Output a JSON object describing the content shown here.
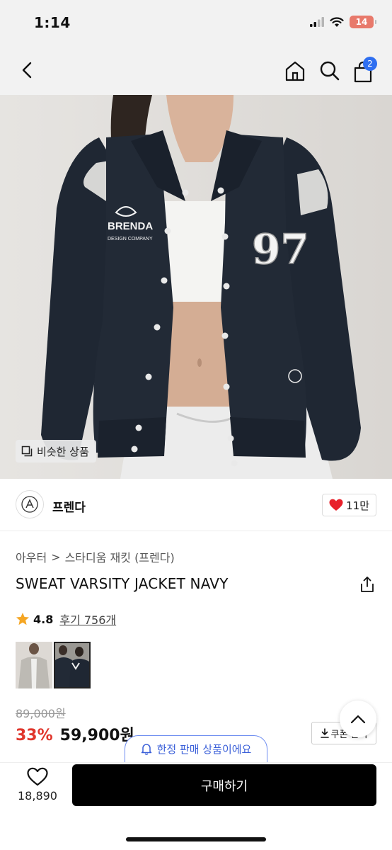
{
  "status_bar": {
    "time": "1:14",
    "battery": "14"
  },
  "nav": {
    "cart_count": "2"
  },
  "similar_button": {
    "label": "비슷한 상품"
  },
  "jacket_print": {
    "logo_line1": "BRENDA",
    "logo_line2": "DESIGN COMPANY",
    "number": "97"
  },
  "brand": {
    "name": "프렌다",
    "likes": "11만"
  },
  "breadcrumb": {
    "category": "아우터",
    "separator": ">",
    "subcategory": "스타디움 재킷 (프렌다)"
  },
  "product": {
    "title": "SWEAT VARSITY JACKET NAVY"
  },
  "rating": {
    "value": "4.8",
    "review_label": "후기 756개"
  },
  "price": {
    "original": "89,000원",
    "discount": "33%",
    "sale": "59,900원"
  },
  "coupon": {
    "label": "쿠폰 받기"
  },
  "toast": {
    "label": "한정 판매 상품이에요"
  },
  "bottom_bar": {
    "wish_count": "18,890",
    "buy_label": "구매하기"
  },
  "colors": {
    "accent_blue": "#2f6ff0",
    "discount_red": "#e0362c",
    "heart_red": "#e8202a",
    "star": "#f5a623"
  }
}
